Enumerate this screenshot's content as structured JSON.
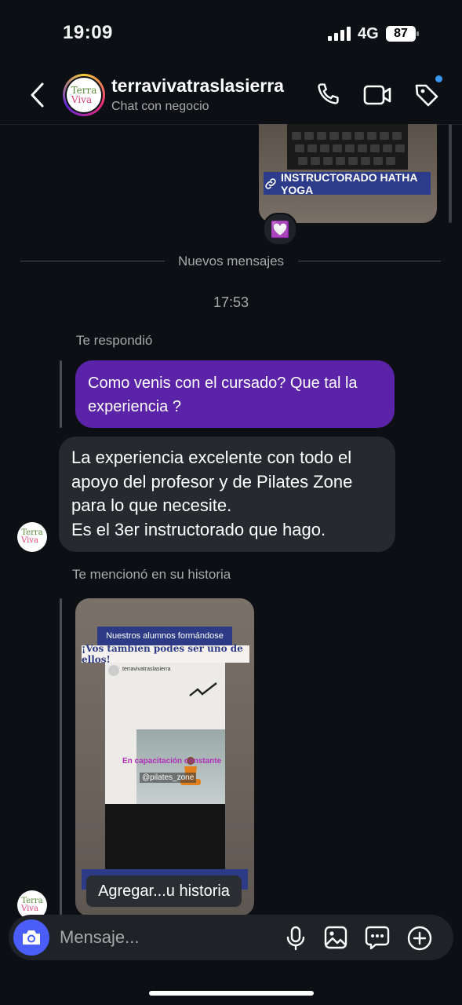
{
  "status_bar": {
    "time": "19:09",
    "network": "4G",
    "battery": "87"
  },
  "header": {
    "title": "terravivatraslasierra",
    "subtitle": "Chat con negocio",
    "avatar_logo": {
      "line1": "Terra",
      "line2": "Viva"
    },
    "icons": [
      "back-icon",
      "phone-icon",
      "video-call-icon",
      "tag-icon"
    ],
    "notification_dot_color": "#3897f0"
  },
  "shared_story_top": {
    "link_label": "INSTRUCTORADO HATHA YOGA",
    "reaction": "💟"
  },
  "separator": {
    "label": "Nuevos mensajes"
  },
  "timestamp": "17:53",
  "reply": {
    "meta": "Te respondió",
    "quoted_text": "Como venis con el cursado? Que tal la experiencia ?",
    "quoted_lines": [
      "Como venis con el cursado? Que tal la",
      "experiencia ?"
    ],
    "message_lines": [
      "La experiencia excelente con todo el",
      "apoyo del profesor y de Pilates Zone",
      "para lo que necesite.",
      "Es el 3er instructorado que hago."
    ]
  },
  "mention": {
    "meta": "Te mencionó en su historia",
    "story": {
      "banner_1": "Nuestros alumnos formándose",
      "banner_2": "¡Vos también podés ser uno de ellos!",
      "inner_handle": "terravivatraslasierra",
      "inner_caption": "En capacitación constante",
      "inner_tag": "@pilates_zone"
    },
    "tooltip": "Agregar...u historia"
  },
  "composer": {
    "placeholder": "Mensaje...",
    "accent": "#4a5df9"
  },
  "colors": {
    "background": "#0c1014",
    "purple_bubble": "#5b23a8",
    "gray_bubble": "#262a2f"
  }
}
